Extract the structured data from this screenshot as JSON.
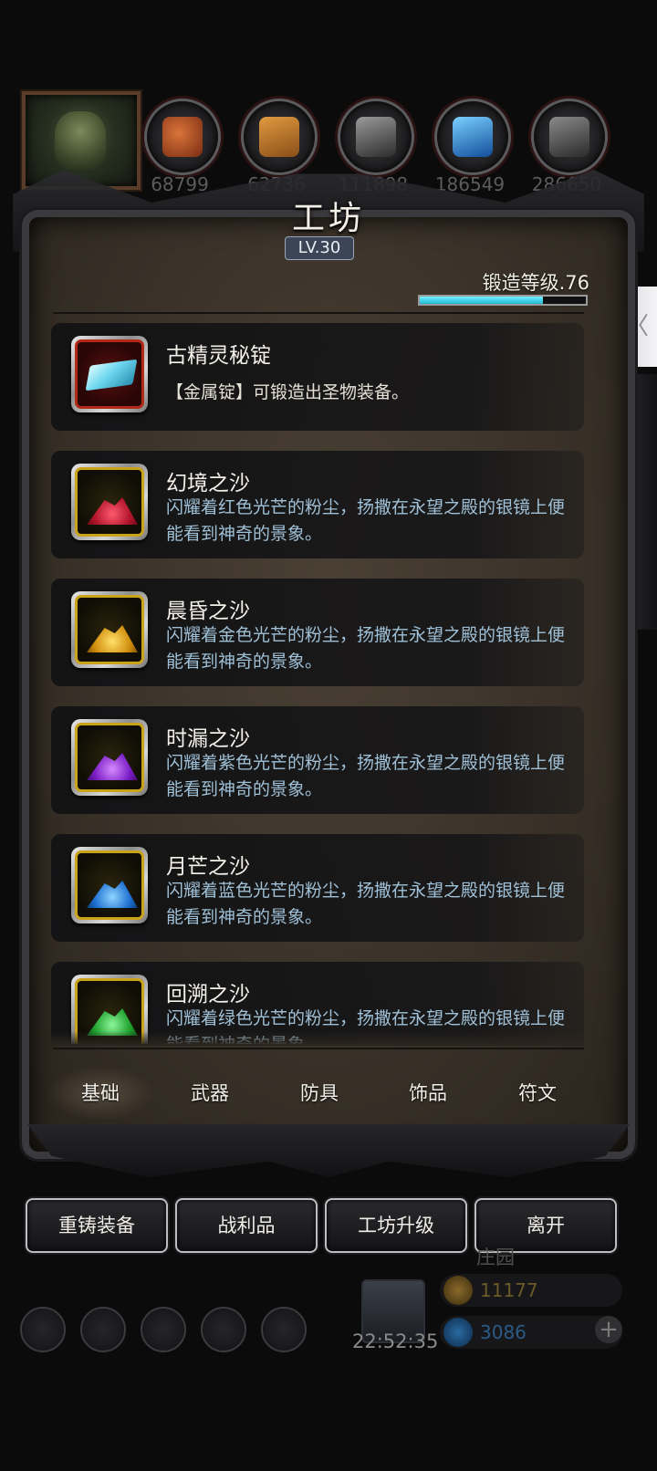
{
  "resources": [
    {
      "icon": "roast-meat-icon",
      "count": "68799"
    },
    {
      "icon": "wood-plank-icon",
      "count": "62736"
    },
    {
      "icon": "iron-ingot-icon",
      "count": "111898"
    },
    {
      "icon": "crystal-icon",
      "count": "186549"
    },
    {
      "icon": "stone-icon",
      "count": "286650"
    }
  ],
  "panel": {
    "title": "工坊",
    "level": "LV.30",
    "forge_level_label": "锻造等级.76",
    "forge_progress": 0.74
  },
  "items": [
    {
      "name": "古精灵秘锭",
      "desc": "【金属锭】可锻造出圣物装备。",
      "icon": "ancient-elf-ingot-icon",
      "color": "#7fe1f5"
    },
    {
      "name": "幻境之沙",
      "desc": "闪耀着红色光芒的粉尘，扬撒在永望之殿的银镜上便能看到神奇的景象。",
      "icon": "red-sand-icon",
      "color": "#e0304a"
    },
    {
      "name": "晨昏之沙",
      "desc": "闪耀着金色光芒的粉尘，扬撒在永望之殿的银镜上便能看到神奇的景象。",
      "icon": "gold-sand-icon",
      "color": "#f2b418"
    },
    {
      "name": "时漏之沙",
      "desc": "闪耀着紫色光芒的粉尘，扬撒在永望之殿的银镜上便能看到神奇的景象。",
      "icon": "purple-sand-icon",
      "color": "#9a2fe0"
    },
    {
      "name": "月芒之沙",
      "desc": "闪耀着蓝色光芒的粉尘，扬撒在永望之殿的银镜上便能看到神奇的景象。",
      "icon": "blue-sand-icon",
      "color": "#2a8fef"
    },
    {
      "name": "回溯之沙",
      "desc": "闪耀着绿色光芒的粉尘，扬撒在永望之殿的银镜上便能看到神奇的景象。",
      "icon": "green-sand-icon",
      "color": "#2fbf3a"
    }
  ],
  "tabs": [
    "基础",
    "武器",
    "防具",
    "饰品",
    "符文"
  ],
  "actions": [
    "重铸装备",
    "战利品",
    "工坊升级",
    "离开"
  ],
  "background": {
    "timer": "22:52:35",
    "estate": "庄园",
    "gold": "11177",
    "gems": "3086",
    "side_tab_glyph": "〈"
  }
}
